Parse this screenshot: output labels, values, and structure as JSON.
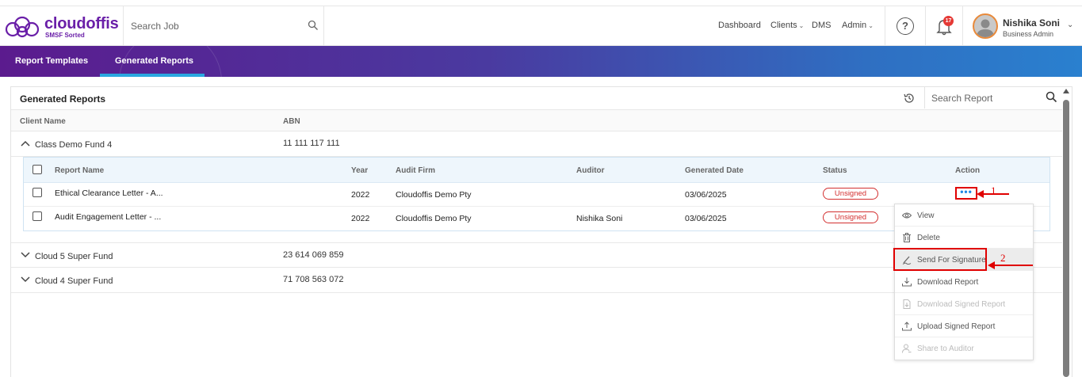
{
  "brand": {
    "name": "cloudoffis",
    "tagline": "SMSF Sorted"
  },
  "search_job": {
    "placeholder": "Search Job"
  },
  "nav": {
    "dashboard": "Dashboard",
    "clients": "Clients",
    "dms": "DMS",
    "admin": "Admin"
  },
  "notifications": {
    "count": "17"
  },
  "user": {
    "name": "Nishika Soni",
    "role": "Business Admin"
  },
  "tabs": [
    {
      "label": "Report Templates",
      "active": false
    },
    {
      "label": "Generated Reports",
      "active": true
    }
  ],
  "panel": {
    "title": "Generated Reports",
    "search_placeholder": "Search Report",
    "columns": {
      "client_name": "Client Name",
      "abn": "ABN"
    }
  },
  "groups": [
    {
      "name": "Class Demo Fund 4",
      "abn": "11 111 117 111",
      "expanded": true
    },
    {
      "name": "Cloud 5 Super Fund",
      "abn": "23 614 069 859",
      "expanded": false
    },
    {
      "name": "Cloud 4 Super Fund",
      "abn": "71 708 563 072",
      "expanded": false
    }
  ],
  "report_columns": {
    "report_name": "Report Name",
    "year": "Year",
    "audit_firm": "Audit Firm",
    "auditor": "Auditor",
    "generated_date": "Generated Date",
    "status": "Status",
    "action": "Action"
  },
  "reports": [
    {
      "name": "Ethical Clearance Letter - A...",
      "year": "2022",
      "audit_firm": "Cloudoffis Demo Pty",
      "auditor": "",
      "generated_date": "03/06/2025",
      "status": "Unsigned"
    },
    {
      "name": "Audit Engagement Letter - ...",
      "year": "2022",
      "audit_firm": "Cloudoffis Demo Pty",
      "auditor": "Nishika Soni",
      "generated_date": "03/06/2025",
      "status": "Unsigned"
    }
  ],
  "action_menu": {
    "items": [
      {
        "label": "View",
        "icon": "eye-icon",
        "disabled": false
      },
      {
        "label": "Delete",
        "icon": "trash-icon",
        "disabled": false
      },
      {
        "label": "Send For Signature",
        "icon": "signature-icon",
        "disabled": false
      },
      {
        "label": "Download Report",
        "icon": "download-icon",
        "disabled": false
      },
      {
        "label": "Download Signed Report",
        "icon": "document-download-icon",
        "disabled": true
      },
      {
        "label": "Upload Signed Report",
        "icon": "upload-icon",
        "disabled": false
      },
      {
        "label": "Share to Auditor",
        "icon": "share-user-icon",
        "disabled": true
      }
    ]
  },
  "annotations": {
    "step1": "1",
    "step2": "2"
  },
  "colors": {
    "brand": "#6a1fa8",
    "status_red": "#d32f2f",
    "annotation_red": "#e00000",
    "accent_blue": "#2aa7e0"
  }
}
